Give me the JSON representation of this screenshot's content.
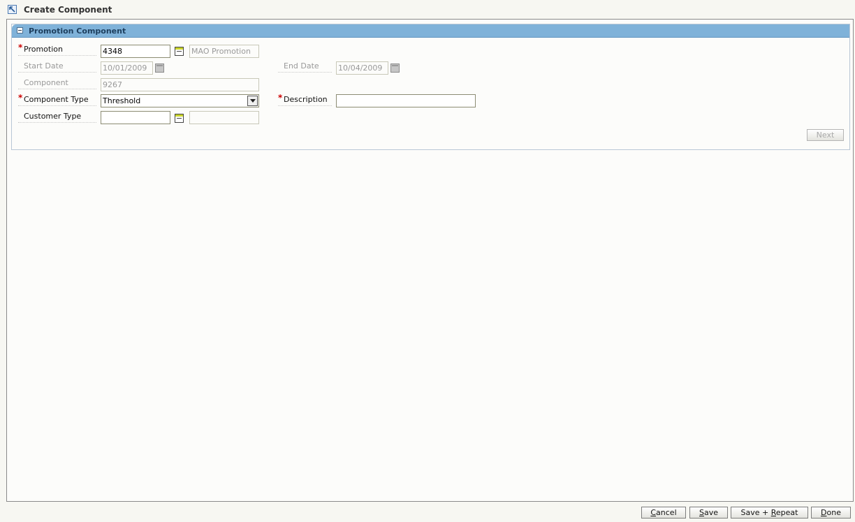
{
  "window": {
    "title": "Create Component"
  },
  "panel": {
    "title": "Promotion Component"
  },
  "form": {
    "promotion": {
      "label": "Promotion",
      "value": "4348",
      "description": "MAO Promotion"
    },
    "start_date": {
      "label": "Start Date",
      "value": "10/01/2009"
    },
    "end_date": {
      "label": "End Date",
      "value": "10/04/2009"
    },
    "component": {
      "label": "Component",
      "value": "9267"
    },
    "component_type": {
      "label": "Component Type",
      "value": "Threshold"
    },
    "description": {
      "label": "Description",
      "value": ""
    },
    "customer_type": {
      "label": "Customer Type",
      "value": "",
      "description": ""
    },
    "required_mark": "*"
  },
  "buttons": {
    "next": "Next",
    "cancel_prefix": "",
    "cancel_key": "C",
    "cancel_rest": "ancel",
    "save_key": "S",
    "save_rest": "ave",
    "save_repeat_prefix": "Save + ",
    "save_repeat_key": "R",
    "save_repeat_rest": "epeat",
    "done_key": "D",
    "done_rest": "one"
  }
}
